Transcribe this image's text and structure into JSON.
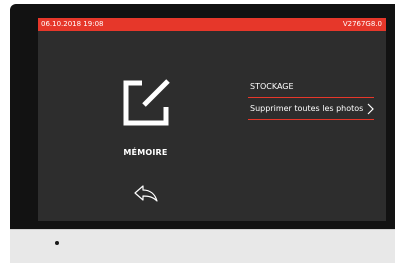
{
  "status_bar": {
    "date_time": "06.10.2018 19:08",
    "version": "V2767G8.0"
  },
  "main": {
    "memory_label": "MÉMOIRE",
    "memory_icon": "edit-square-icon",
    "back_icon": "back-arrow-icon"
  },
  "menu": {
    "items": [
      {
        "label": "STOCKAGE",
        "icon": ""
      },
      {
        "label": "Supprimer toutes les photos",
        "icon": "chevron-right-icon"
      }
    ]
  },
  "colors": {
    "accent": "#e6372a",
    "screen_bg": "#2d2d2d",
    "bezel": "#121212"
  }
}
